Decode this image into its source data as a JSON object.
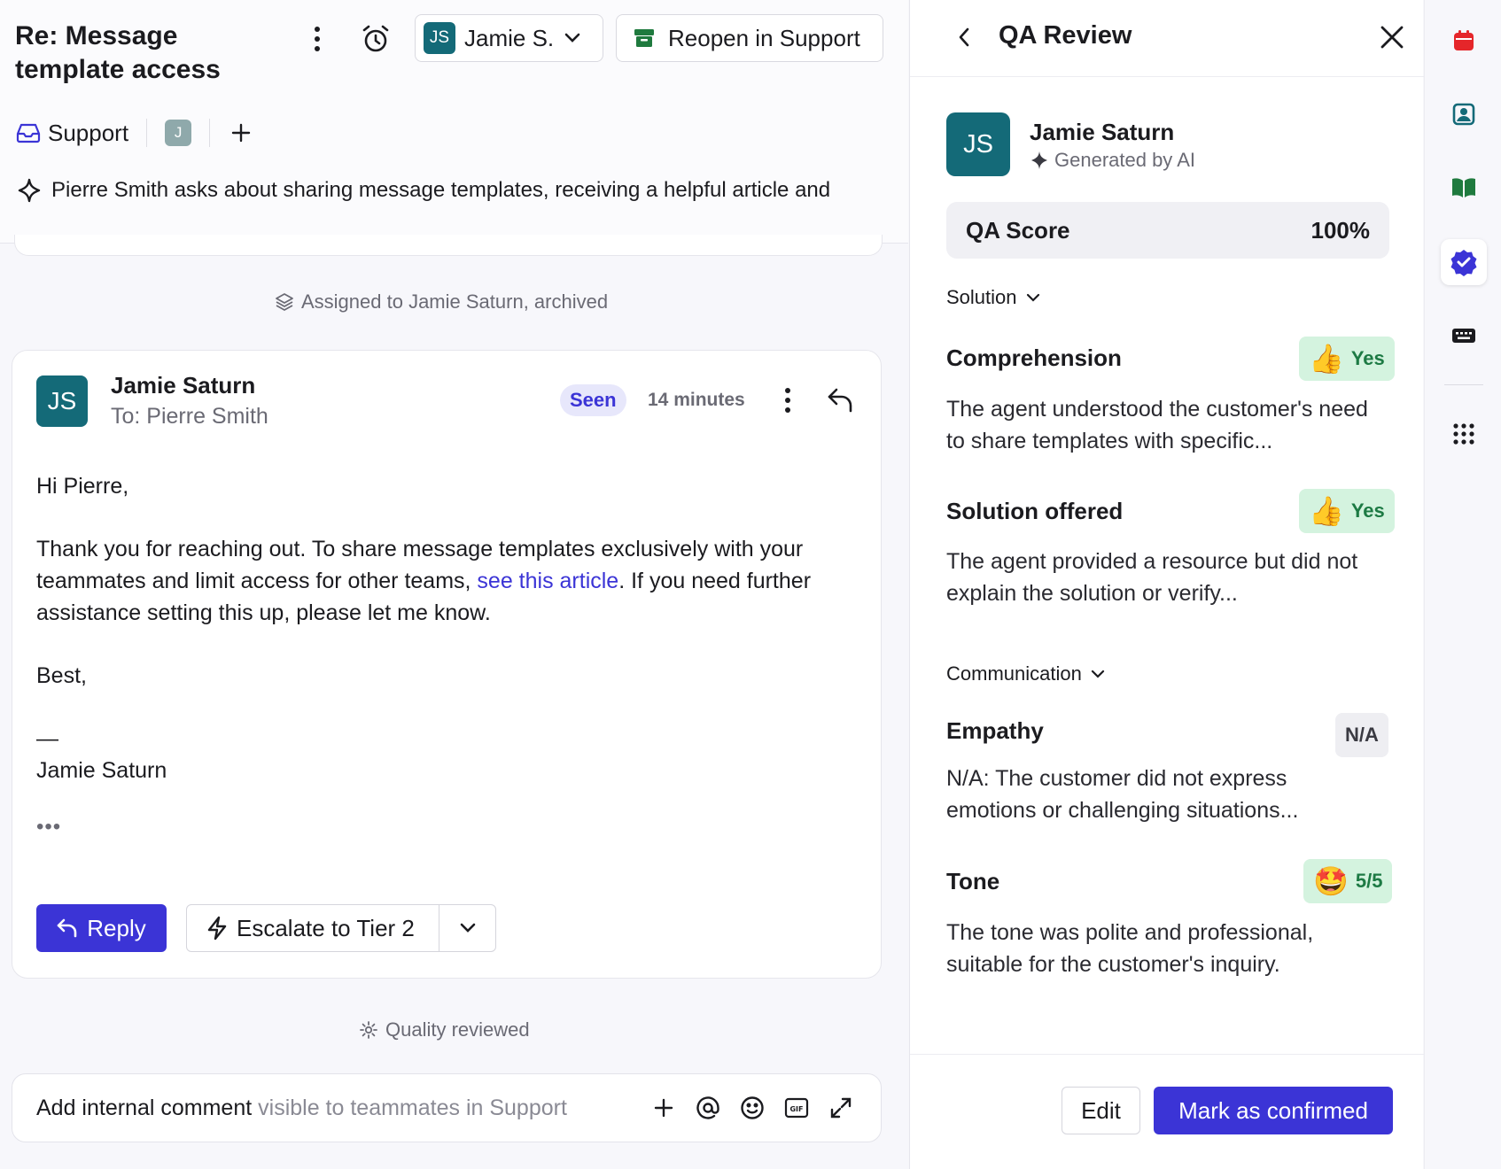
{
  "conversation": {
    "title": "Re: Message template access",
    "assignee_short": "Jamie S.",
    "assignee_initials": "JS",
    "reopen_label": "Reopen in Support",
    "inbox_label": "Support",
    "participant_initial": "J",
    "ai_summary": "Pierre Smith asks about sharing message templates, receiving a helpful article and"
  },
  "timeline": {
    "assigned_event": "Assigned to Jamie Saturn, archived",
    "quality_event": "Quality reviewed"
  },
  "message": {
    "initials": "JS",
    "sender": "Jamie Saturn",
    "recipient": "To: Pierre Smith",
    "seen_label": "Seen",
    "time": "14 minutes",
    "greeting": "Hi Pierre,",
    "body_before_link": "Thank you for reaching out. To share message templates exclusively with your teammates and limit access for other teams, ",
    "link_text": "see this article",
    "body_after_link": ". If you need further assistance setting this up, please let me know.",
    "closing": "Best,",
    "dash": "—",
    "signature": "Jamie Saturn",
    "more": "•••",
    "reply_label": "Reply",
    "escalate_label": "Escalate to Tier 2"
  },
  "composer": {
    "placeholder_main": "Add internal comment",
    "placeholder_muted": " visible to teammates in Support"
  },
  "qa_review": {
    "title": "QA Review",
    "initials": "JS",
    "agent_name": "Jamie Saturn",
    "generated_label": "Generated by AI",
    "score_label": "QA Score",
    "score_value": "100%",
    "sections": [
      {
        "label": "Solution",
        "criteria": [
          {
            "name": "Comprehension",
            "badge_emoji": "👍",
            "badge_text": "Yes",
            "description": "The agent understood the customer's need to share templates with specific..."
          },
          {
            "name": "Solution offered",
            "badge_emoji": "👍",
            "badge_text": "Yes",
            "description": "The agent provided a resource but did not explain the solution or verify..."
          }
        ]
      },
      {
        "label": "Communication",
        "criteria": [
          {
            "name": "Empathy",
            "badge_emoji": "",
            "badge_text": "N/A",
            "description": "N/A: The customer did not express emotions or challenging situations..."
          },
          {
            "name": "Tone",
            "badge_emoji": "🤩",
            "badge_text": "5/5",
            "description": "The tone was polite and professional, suitable for the customer's inquiry."
          }
        ]
      }
    ],
    "edit_label": "Edit",
    "confirm_label": "Mark as confirmed"
  },
  "rail_icons": [
    "calendar-icon",
    "contact-card-icon",
    "book-icon",
    "verified-badge-icon",
    "keyboard-icon",
    "apps-grid-icon"
  ],
  "colors": {
    "accent": "#3b34d6",
    "avatar_teal": "#146a78",
    "yes_badge_bg": "#d4f3df",
    "yes_badge_text": "#1d7a44",
    "archive_green": "#1f7a3e",
    "calendar_red": "#e5262a"
  }
}
